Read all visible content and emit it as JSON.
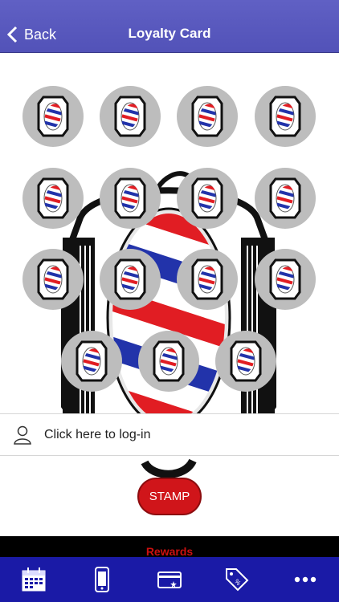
{
  "nav": {
    "back_label": "Back",
    "title": "Loyalty Card"
  },
  "login": {
    "label": "Click here to log-in",
    "icon": "user-icon"
  },
  "stamp_button": {
    "label": "STAMP"
  },
  "rewards": {
    "label": "Rewards"
  },
  "stamps": {
    "total": 15,
    "icon": "barber-pole-icon"
  },
  "tabs": [
    {
      "name": "calendar-icon"
    },
    {
      "name": "phone-icon"
    },
    {
      "name": "card-icon"
    },
    {
      "name": "tag-icon"
    },
    {
      "name": "more-icon"
    }
  ],
  "colors": {
    "nav": "#5656bb",
    "tabbar": "#1a1aa6",
    "stamp_button": "#d0151a",
    "rewards_text": "#cc1010"
  }
}
